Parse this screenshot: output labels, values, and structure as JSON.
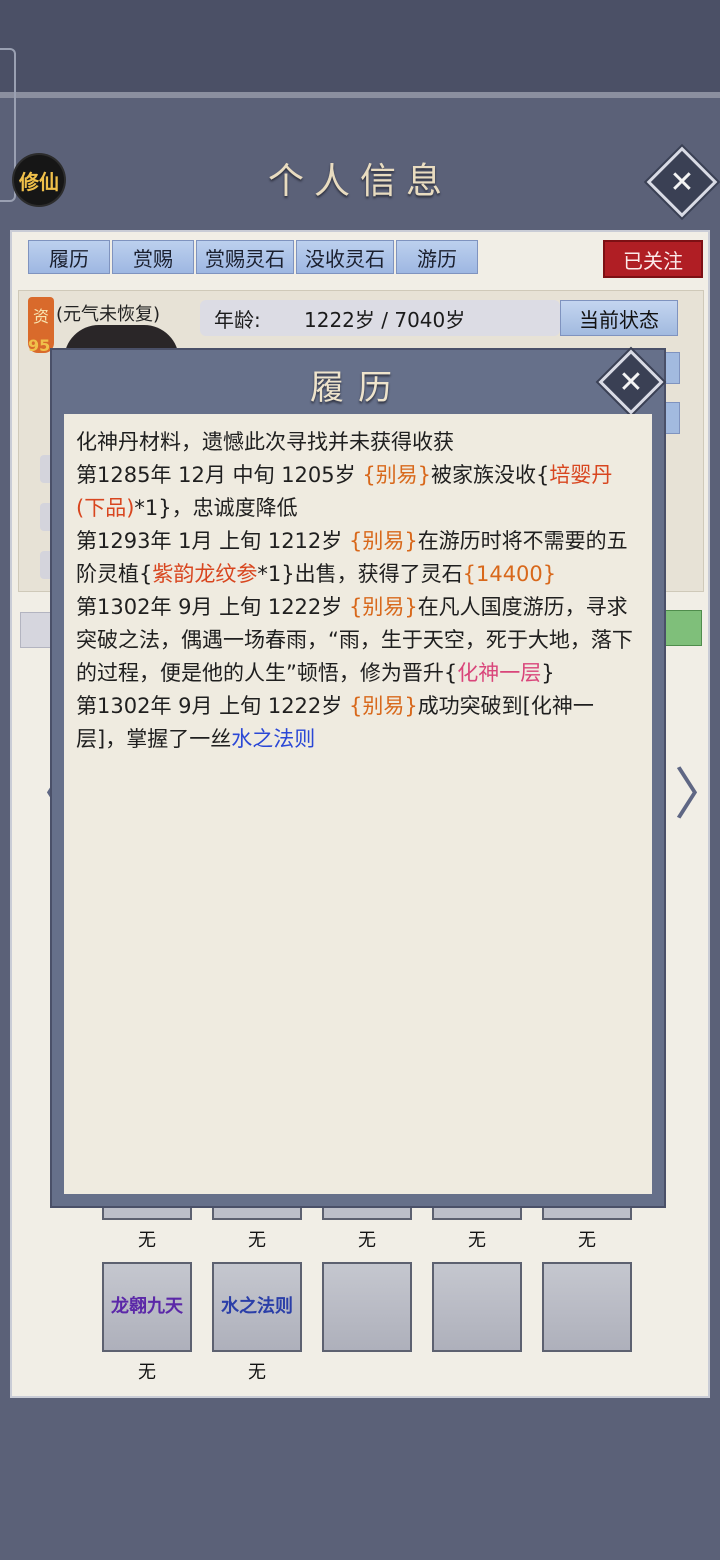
{
  "header": {
    "badge": "修仙",
    "title": "个人信息",
    "close_glyph": "✕"
  },
  "tabs": [
    "履历",
    "赏赐",
    "赏赐灵石",
    "没收灵石",
    "游历"
  ],
  "follow_button": "已关注",
  "profile": {
    "zi_label": "资",
    "zi_value": "95",
    "status_note": "(元气未恢复)",
    "age_label": "年龄:",
    "age_value": "1222岁 / 7040岁",
    "current_state_button": "当前状态"
  },
  "slots_row1_labels": [
    "无",
    "无",
    "无",
    "无",
    "无"
  ],
  "slots_row2": [
    {
      "name": "龙翱九天",
      "label": "无"
    },
    {
      "name": "水之法则",
      "label": "无"
    },
    {
      "name": "",
      "label": ""
    },
    {
      "name": "",
      "label": ""
    },
    {
      "name": "",
      "label": ""
    }
  ],
  "modal": {
    "title": "履历",
    "close_glyph": "✕",
    "entries": {
      "e0": "化神丹材料，遗憾此次寻找并未获得收获",
      "e1_a": "第1285年 12月 中旬 1205岁 ",
      "e1_b": "{别易}",
      "e1_c": "被家族没收{",
      "e1_d": "培婴丹(下品)",
      "e1_e": "*1}，忠诚度降低",
      "e2_a": "第1293年 1月 上旬 1212岁 ",
      "e2_b": "{别易}",
      "e2_c": "在游历时将不需要的五阶灵植{",
      "e2_d": "紫韵龙纹参",
      "e2_e": "*1}出售，获得了灵石",
      "e2_f": "{14400}",
      "e3_a": "第1302年 9月 上旬 1222岁 ",
      "e3_b": "{别易}",
      "e3_c": "在凡人国度游历，寻求突破之法，偶遇一场春雨，“雨，生于天空，死于大地，落下的过程，便是他的人生”顿悟，修为晋升{",
      "e3_d": "化神一层",
      "e3_e": "}",
      "e4_a": "第1302年 9月 上旬 1222岁 ",
      "e4_b": "{别易}",
      "e4_c": "成功突破到[化神一层]，掌握了一丝",
      "e4_d": "水之法则"
    }
  },
  "nav": {
    "left": "〈",
    "right": "〉"
  },
  "colors": {
    "highlight_orange": "#d8681b",
    "highlight_red": "#d8461f",
    "highlight_pink": "#d9457a",
    "highlight_blue": "#2a47d6",
    "follow_red": "#b01e24",
    "tab_blue": "#a7bde4"
  }
}
